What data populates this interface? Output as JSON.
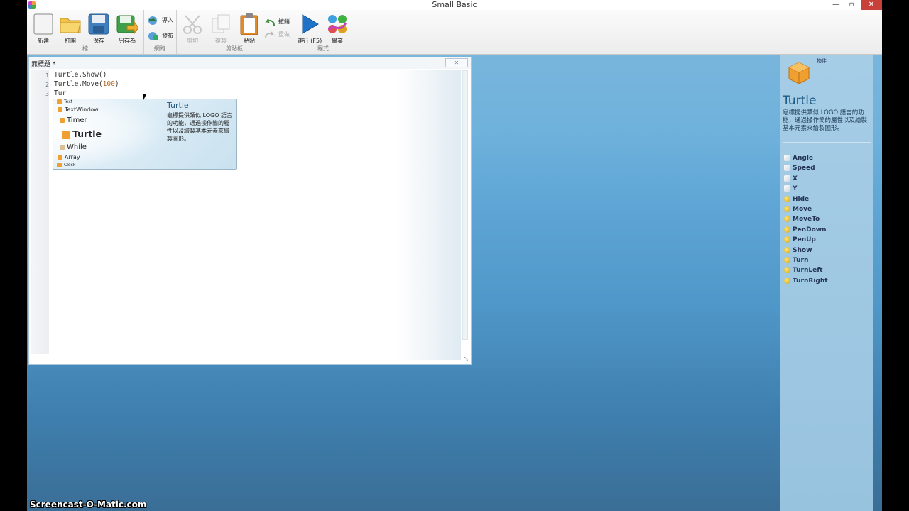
{
  "window": {
    "title": "Small Basic",
    "minimize": "—",
    "maximize": "▫",
    "close": "✕"
  },
  "ribbon": {
    "file": {
      "label": "檔",
      "new": "新建",
      "open": "打開",
      "save": "保存",
      "save_as": "另存為"
    },
    "web": {
      "label": "網路",
      "import": "導入",
      "publish": "發布"
    },
    "clipboard": {
      "label": "剪貼板",
      "cut": "剪切",
      "copy": "複製",
      "paste": "粘貼",
      "undo": "撤銷",
      "redo": "重做"
    },
    "program": {
      "label": "程式",
      "run": "運行 (F5)",
      "graduate": "畢業"
    }
  },
  "editor": {
    "tab_title": "無標題 *",
    "close": "✕",
    "resize": "⤡",
    "lines": [
      {
        "no": "1",
        "text": "Turtle.Show()"
      },
      {
        "no": "2",
        "pre": "Turtle.Move(",
        "num": "100",
        "post": ")"
      },
      {
        "no": "3",
        "text": "Tur"
      }
    ]
  },
  "intellisense": {
    "items": [
      "Text",
      "TextWindow",
      "Timer",
      "Turtle",
      "While",
      "Array",
      "Clock"
    ],
    "selected": "Turtle",
    "title": "Turtle",
    "description": "龜標提供類似 LOGO 語言的功能，通過操作簡的屬性以及繪製基本元素來繪製圖形。"
  },
  "sidebar": {
    "category": "物件",
    "title": "Turtle",
    "description": "龜標提供類似 LOGO 語言的功能，通過操作簡的屬性以及繪製基本元素來繪製圖形。",
    "properties": [
      "Angle",
      "Speed",
      "X",
      "Y"
    ],
    "operations": [
      "Hide",
      "Move",
      "MoveTo",
      "PenDown",
      "PenUp",
      "Show",
      "Turn",
      "TurnLeft",
      "TurnRight"
    ]
  },
  "watermark": "Screencast-O-Matic.com",
  "colors": {
    "accent": "#1d5a85",
    "run_button": "#1e73c8",
    "close_button": "#c7413a"
  }
}
